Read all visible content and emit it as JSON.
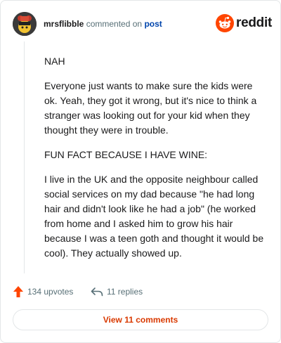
{
  "header": {
    "username": "mrsflibble",
    "action_text": "commented on",
    "post_link": "post",
    "brand": "reddit"
  },
  "comment": {
    "paragraphs": [
      "NAH",
      "Everyone just wants to make sure the kids were ok. Yeah, they got it wrong, but it's nice to think a stranger was looking out for your kid when they thought they were in trouble.",
      "FUN FACT BECAUSE I HAVE WINE:",
      "I live in the UK and the opposite neighbour called social services on my dad because \"he had long hair and didn't look like he had a job\" (he worked from home and I asked him to grow his hair because I was a teen goth and thought it would be cool). They actually showed up."
    ]
  },
  "actions": {
    "upvotes": "134 upvotes",
    "replies": "11 replies"
  },
  "footer": {
    "view_comments": "View 11 comments"
  },
  "colors": {
    "brand_orange": "#ff4500",
    "link_blue": "#0045ac",
    "muted": "#576f76",
    "button_text": "#d93900"
  }
}
